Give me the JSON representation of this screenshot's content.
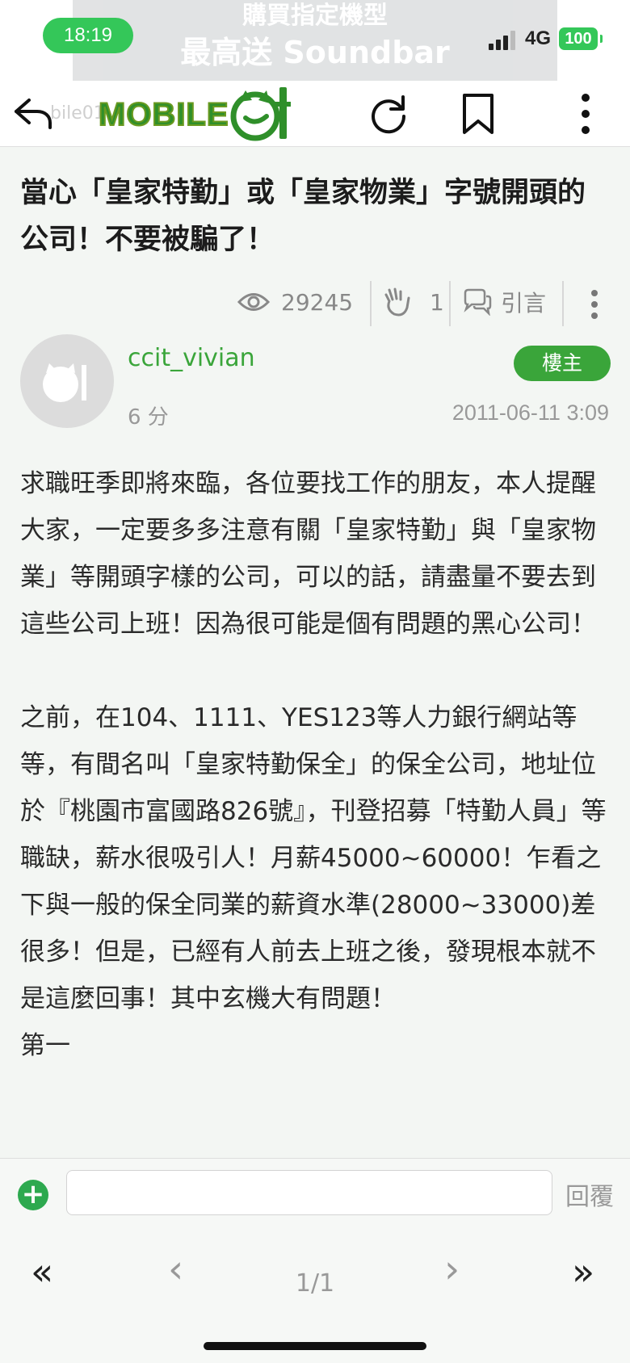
{
  "status": {
    "time": "18:19",
    "network": "4G",
    "battery": "100"
  },
  "ad": {
    "line1": "購買指定機型",
    "line2": "最高送 Soundbar"
  },
  "toolbar": {
    "faint_url": "bile01",
    "logo_text": "MOBILE"
  },
  "article": {
    "title": "當心「皇家特勤」或「皇家物業」字號開頭的公司！不要被騙了！",
    "views": "29245",
    "likes": "1",
    "quote_label": "引言"
  },
  "post": {
    "author": "ccit_vivian",
    "badge": "樓主",
    "ago": "6 分",
    "date": "2011-06-11 3:09",
    "paragraphs": [
      "求職旺季即將來臨，各位要找工作的朋友，本人提醒大家，一定要多多注意有關「皇家特勤」與「皇家物業」等開頭字樣的公司，可以的話，請盡量不要去到這些公司上班！因為很可能是個有問題的黑心公司！",
      "之前，在104、1111、YES123等人力銀行網站等等，有間名叫「皇家特勤保全」的保全公司，地址位於『桃園市富國路826號』，刊登招募「特勤人員」等職缺，薪水很吸引人！月薪45000~60000！乍看之下與一般的保全同業的薪資水準(28000~33000)差很多！但是，已經有人前去上班之後，發現根本就不是這麼回事！其中玄機大有問題！",
      "第一"
    ]
  },
  "reply": {
    "label": "回覆"
  },
  "pager": {
    "first": "«",
    "prev": "‹",
    "page": "1/1",
    "next": "›",
    "last": "»"
  },
  "colors": {
    "brand_green": "#3aa53a",
    "status_green": "#34c759"
  }
}
